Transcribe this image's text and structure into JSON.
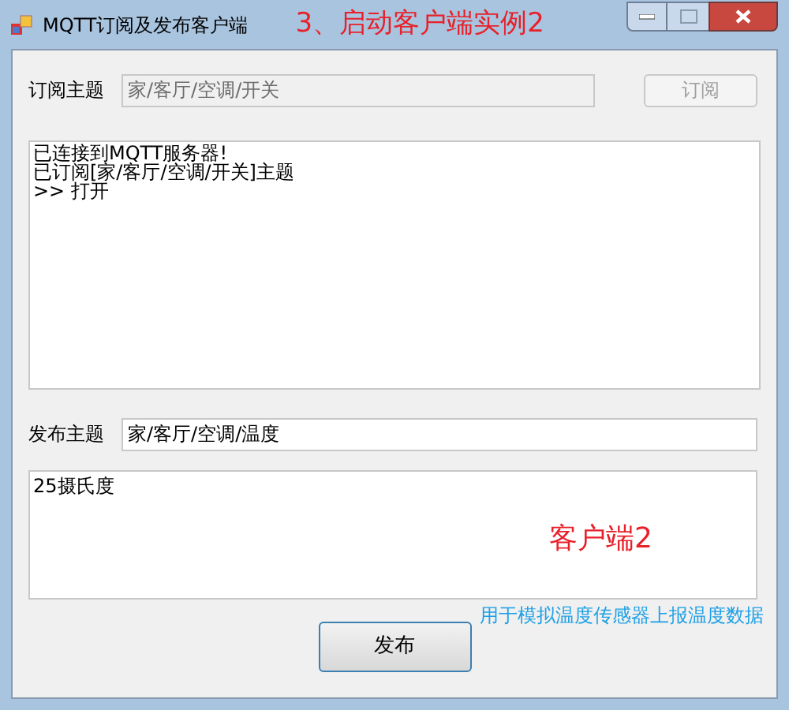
{
  "window": {
    "title": "MQTT订阅及发布客户端",
    "annotation": "3、启动客户端实例2"
  },
  "subscribe": {
    "label": "订阅主题",
    "value": "家/客厅/空调/开关",
    "disabled": true,
    "button": "订阅"
  },
  "log": {
    "lines": [
      "已连接到MQTT服务器!",
      "已订阅[家/客厅/空调/开关]主题",
      ">> 打开"
    ]
  },
  "publish": {
    "label": "发布主题",
    "value": "家/客厅/空调/温度",
    "message": "25摄氏度",
    "button": "发布"
  },
  "annotations": [
    {
      "text": "客户端2",
      "kind": "title"
    },
    {
      "text": "用于模拟温度传感器上报温度数据",
      "kind": "note"
    }
  ]
}
